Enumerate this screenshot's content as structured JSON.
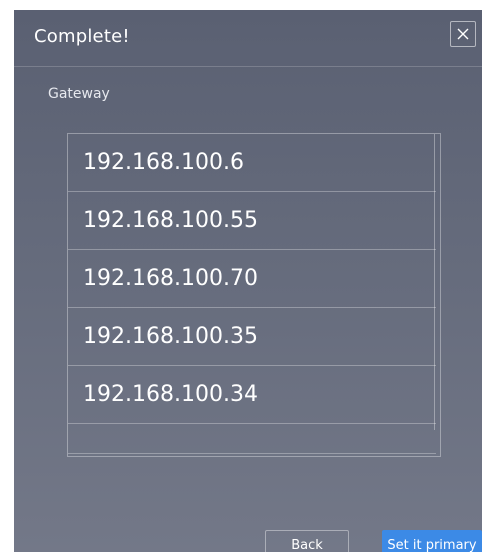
{
  "dialog": {
    "title": "Complete!",
    "close_icon": "close-icon"
  },
  "section": {
    "label": "Gateway"
  },
  "gateways": [
    "192.168.100.6",
    "192.168.100.55",
    "192.168.100.70",
    "192.168.100.35",
    "192.168.100.34"
  ],
  "buttons": {
    "back_label": "Back",
    "primary_label": "Set it primary"
  },
  "colors": {
    "accent": "#3c8ae6",
    "dialog_bg": "#656b7c"
  }
}
